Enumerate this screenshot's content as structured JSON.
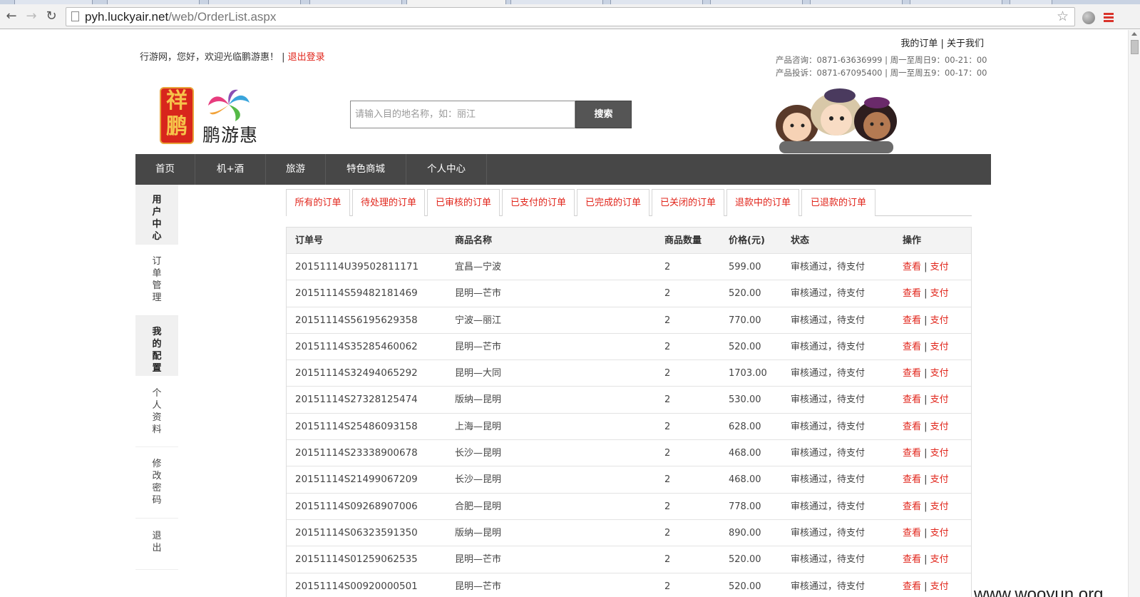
{
  "browser": {
    "url_host": "pyh.luckyair.net",
    "url_path": "/web/OrderList.aspx"
  },
  "header": {
    "welcome_text": "行游网，您好，欢迎光临鹏游惠！ | ",
    "logout_label": "退出登录",
    "my_orders_link": "我的订单",
    "separator": " | ",
    "about_link": "关于我们",
    "contact_line1": "产品咨询：0871-63636999 | 周一至周日9：00-21：00",
    "contact_line2": "产品投诉：0871-67095400 | 周一至周五9：00-17：00",
    "logo_seal_text": "祥鹏",
    "logo_text": "鹏游惠"
  },
  "search": {
    "placeholder": "请输入目的地名称，如：丽江",
    "button_label": "搜索"
  },
  "nav": {
    "items": [
      "首页",
      "机+酒",
      "旅游",
      "特色商城",
      "个人中心"
    ]
  },
  "sidebar": {
    "items": [
      "用户中心",
      "订单管理",
      "我的配置",
      "个人资料",
      "修改密码",
      "退出"
    ]
  },
  "tabs": [
    "所有的订单",
    "待处理的订单",
    "已审核的订单",
    "已支付的订单",
    "已完成的订单",
    "已关闭的订单",
    "退款中的订单",
    "已退款的订单"
  ],
  "table": {
    "columns": [
      "订单号",
      "商品名称",
      "商品数量",
      "价格(元)",
      "状态",
      "操作"
    ],
    "view_label": "查看",
    "pay_label": "支付",
    "op_sep": " | ",
    "rows": [
      {
        "id": "20151114U39502811171",
        "name": "宜昌—宁波",
        "qty": "2",
        "price": "599.00",
        "status": "审核通过，待支付"
      },
      {
        "id": "20151114S59482181469",
        "name": "昆明—芒市",
        "qty": "2",
        "price": "520.00",
        "status": "审核通过，待支付"
      },
      {
        "id": "20151114S56195629358",
        "name": "宁波—丽江",
        "qty": "2",
        "price": "770.00",
        "status": "审核通过，待支付"
      },
      {
        "id": "20151114S35285460062",
        "name": "昆明—芒市",
        "qty": "2",
        "price": "520.00",
        "status": "审核通过，待支付"
      },
      {
        "id": "20151114S32494065292",
        "name": "昆明—大同",
        "qty": "2",
        "price": "1703.00",
        "status": "审核通过，待支付"
      },
      {
        "id": "20151114S27328125474",
        "name": "版纳—昆明",
        "qty": "2",
        "price": "530.00",
        "status": "审核通过，待支付"
      },
      {
        "id": "20151114S25486093158",
        "name": "上海—昆明",
        "qty": "2",
        "price": "628.00",
        "status": "审核通过，待支付"
      },
      {
        "id": "20151114S23338900678",
        "name": "长沙—昆明",
        "qty": "2",
        "price": "468.00",
        "status": "审核通过，待支付"
      },
      {
        "id": "20151114S21499067209",
        "name": "长沙—昆明",
        "qty": "2",
        "price": "468.00",
        "status": "审核通过，待支付"
      },
      {
        "id": "20151114S09268907006",
        "name": "合肥—昆明",
        "qty": "2",
        "price": "778.00",
        "status": "审核通过，待支付"
      },
      {
        "id": "20151114S06323591350",
        "name": "版纳—昆明",
        "qty": "2",
        "price": "890.00",
        "status": "审核通过，待支付"
      },
      {
        "id": "20151114S01259062535",
        "name": "昆明—芒市",
        "qty": "2",
        "price": "520.00",
        "status": "审核通过，待支付"
      },
      {
        "id": "20151114S00920000501",
        "name": "昆明—芒市",
        "qty": "2",
        "price": "520.00",
        "status": "审核通过，待支付"
      }
    ]
  },
  "watermark": "www.wooyun.org",
  "colors": {
    "accent_red": "#e1251b",
    "nav_bg": "#474747"
  }
}
